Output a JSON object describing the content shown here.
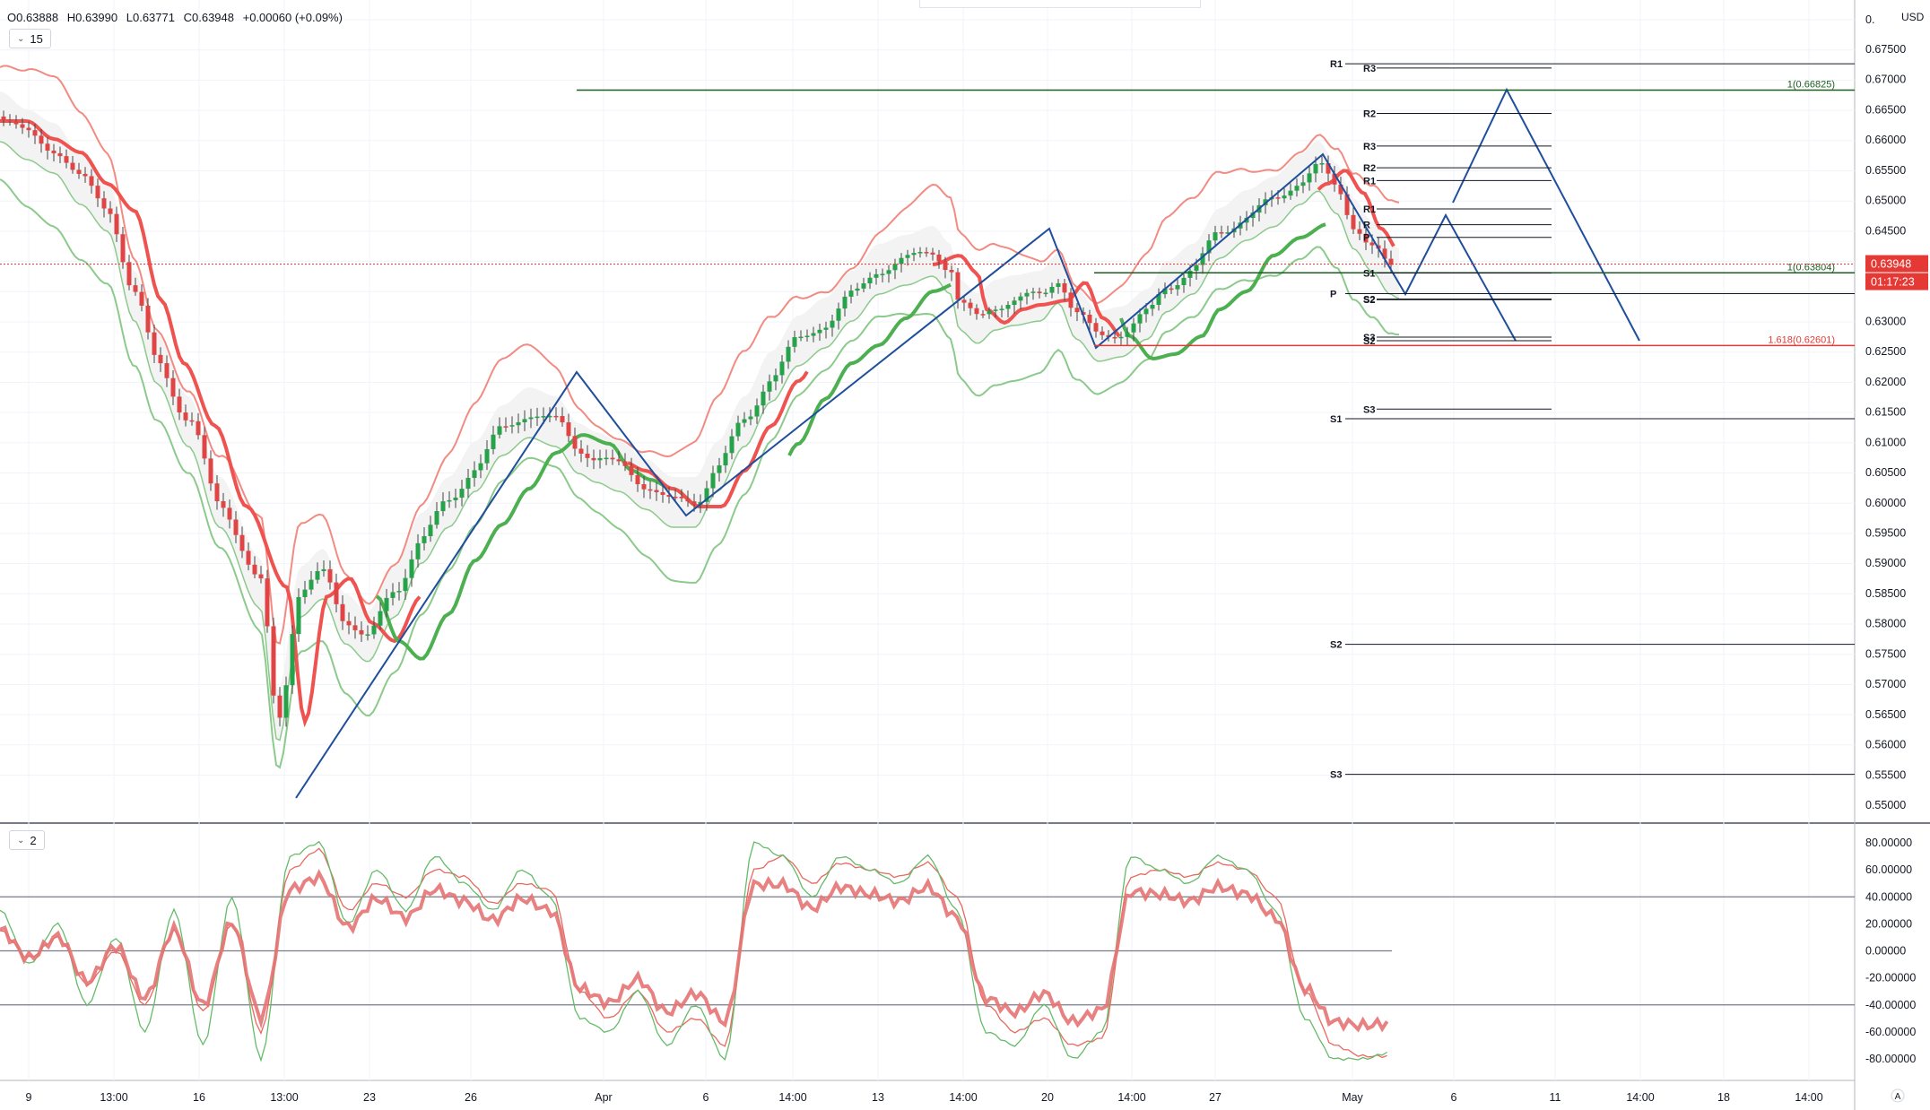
{
  "header": {
    "open": "O0.63888",
    "high": "H0.63990",
    "low": "L0.63771",
    "close": "C0.63948",
    "change": "+0.00060 (+0.09%)"
  },
  "legend": {
    "main_interval": "15",
    "sub_interval": "2"
  },
  "currency": "USD",
  "colors": {
    "bull": "#26a24a",
    "bear": "#e04545",
    "upper_band": "#f28b82",
    "lower_band": "#8cca8c",
    "ema_red": "#ef5350",
    "ema_green": "#4caf50",
    "zigzag": "#1f4e9c",
    "fib_green": "#1b5e20",
    "fib_red": "#e53935",
    "price_line": "#e53935"
  },
  "price_axis": {
    "ticks": [
      "0.67500",
      "0.67000",
      "0.66500",
      "0.66000",
      "0.65500",
      "0.65000",
      "0.64500",
      "0.64000",
      "0.63000",
      "0.62500",
      "0.62000",
      "0.61500",
      "0.61000",
      "0.60500",
      "0.60000",
      "0.59500",
      "0.59000",
      "0.58500",
      "0.58000",
      "0.57500",
      "0.57000",
      "0.56500",
      "0.56000",
      "0.55500",
      "0.55000"
    ],
    "top_clip": "0.",
    "current_price": "0.63948",
    "countdown": "01:17:23"
  },
  "osc_axis": {
    "ticks": [
      "80.00000",
      "60.00000",
      "40.00000",
      "20.00000",
      "0.00000",
      "-20.00000",
      "-40.00000",
      "-60.00000",
      "-80.00000"
    ]
  },
  "time_axis": {
    "labels": [
      "9",
      "13:00",
      "16",
      "13:00",
      "23",
      "26",
      "Apr",
      "6",
      "14:00",
      "13",
      "14:00",
      "20",
      "14:00",
      "27",
      "May",
      "6",
      "11",
      "14:00",
      "18",
      "14:00"
    ],
    "corner": "A"
  },
  "pivots": [
    {
      "label": "R1",
      "price": 0.6726
    },
    {
      "label": "R3",
      "price": 0.6719
    },
    {
      "label": "R2",
      "price": 0.6644
    },
    {
      "label": "R3",
      "price": 0.659
    },
    {
      "label": "R2",
      "price": 0.6554
    },
    {
      "label": "R1",
      "price": 0.6533
    },
    {
      "label": "R1",
      "price": 0.6486
    },
    {
      "label": "R",
      "price": 0.646
    },
    {
      "label": "P",
      "price": 0.6439
    },
    {
      "label": "S1",
      "price": 0.638
    },
    {
      "label": "P",
      "price": 0.6346
    },
    {
      "label": "S2",
      "price": 0.6337
    },
    {
      "label": "S2",
      "price": 0.6336
    },
    {
      "label": "S3",
      "price": 0.6274
    },
    {
      "label": "S2",
      "price": 0.6268
    },
    {
      "label": "S3",
      "price": 0.6155
    },
    {
      "label": "S1",
      "price": 0.6139
    },
    {
      "label": "S2",
      "price": 0.5766
    },
    {
      "label": "S3",
      "price": 0.5551
    }
  ],
  "fib": [
    {
      "label": "1(0.66825)",
      "price": 0.66825
    },
    {
      "label": "1(0.63804)",
      "price": 0.63804
    },
    {
      "label": "1.618(0.62601)",
      "price": 0.62601
    }
  ],
  "chart_data": {
    "type": "line",
    "instrument_currency": "USD",
    "main_interval": "15",
    "closes_approx": [
      0.652,
      0.648,
      0.65,
      0.646,
      0.642,
      0.636,
      0.628,
      0.618,
      0.611,
      0.605,
      0.598,
      0.59,
      0.575,
      0.56,
      0.58,
      0.585,
      0.576,
      0.59,
      0.598,
      0.604,
      0.601,
      0.607,
      0.613,
      0.618,
      0.614,
      0.609,
      0.606,
      0.602,
      0.606,
      0.611,
      0.618,
      0.626,
      0.632,
      0.636,
      0.637,
      0.64,
      0.642,
      0.638,
      0.633,
      0.63,
      0.634,
      0.638,
      0.634,
      0.63,
      0.634,
      0.636,
      0.639,
      0.641,
      0.643,
      0.647,
      0.65,
      0.653,
      0.656,
      0.65,
      0.645,
      0.64,
      0.639
    ],
    "zigzag_points": [
      [
        0.5509
      ],
      [
        0.6215
      ],
      [
        0.598
      ],
      [
        0.645
      ],
      [
        0.626
      ],
      [
        0.6575
      ],
      [
        0.634
      ],
      [
        0.6475
      ],
      [
        0.627
      ],
      [
        0.668
      ],
      [
        0.626
      ]
    ],
    "fib_levels": [
      0.66825,
      0.63804,
      0.62601
    ],
    "oscillator": {
      "interval": "2",
      "levels": [
        40,
        0,
        -40
      ],
      "range": [
        -90,
        90
      ],
      "fast_approx": [
        30,
        -10,
        20,
        -40,
        10,
        -60,
        30,
        -70,
        40,
        -80,
        70,
        80,
        20,
        60,
        30,
        70,
        50,
        30,
        60,
        40,
        -50,
        -60,
        -30,
        -70,
        -40,
        -80,
        80,
        70,
        40,
        70,
        60,
        50,
        70,
        30,
        -60,
        -70,
        -40,
        -80,
        -60,
        70,
        60,
        50,
        70,
        60,
        30,
        -50,
        -80,
        -80,
        -75
      ],
      "slow_approx": [
        15,
        -5,
        10,
        -25,
        0,
        -40,
        15,
        -45,
        20,
        -60,
        60,
        75,
        30,
        50,
        40,
        60,
        55,
        35,
        50,
        45,
        -30,
        -50,
        -30,
        -60,
        -50,
        -70,
        60,
        70,
        50,
        65,
        60,
        55,
        65,
        40,
        -40,
        -60,
        -50,
        -70,
        -65,
        55,
        60,
        55,
        65,
        60,
        40,
        -30,
        -70,
        -78,
        -78
      ]
    }
  }
}
